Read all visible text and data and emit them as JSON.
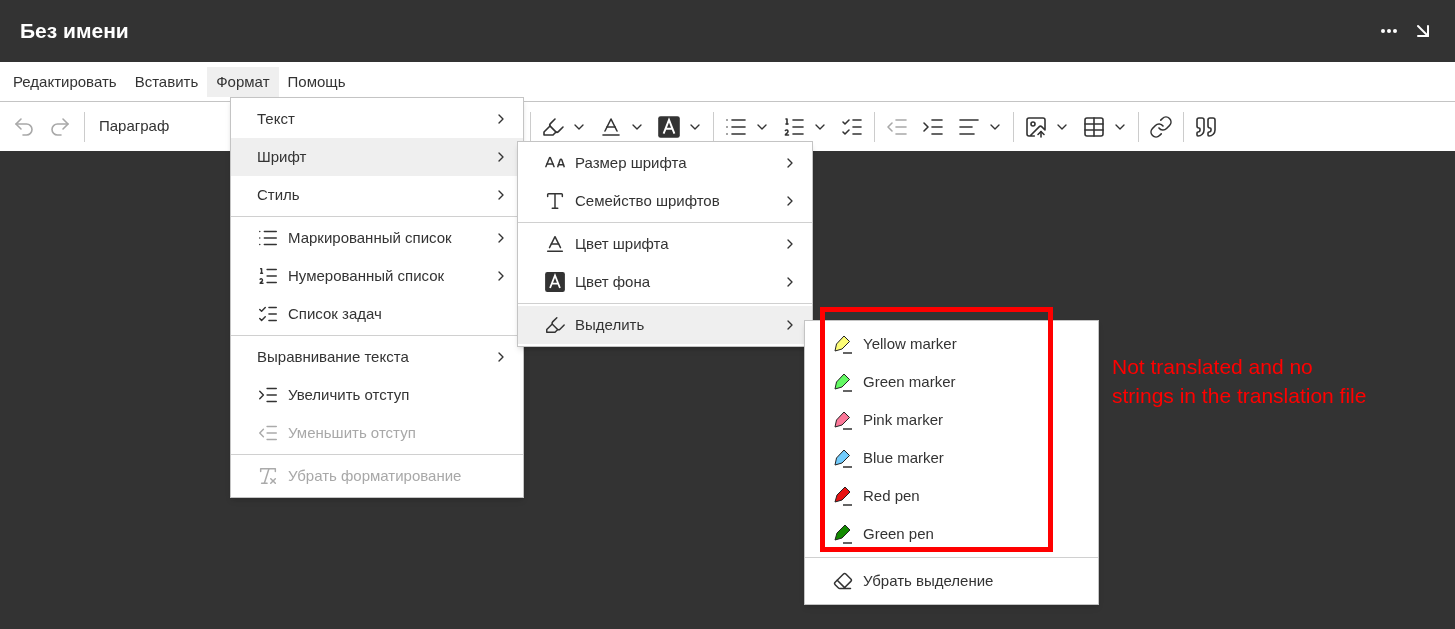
{
  "window": {
    "title": "Без имени"
  },
  "menubar": [
    {
      "label": "Редактировать",
      "selected": false
    },
    {
      "label": "Вставить",
      "selected": false
    },
    {
      "label": "Формат",
      "selected": true
    },
    {
      "label": "Помощь",
      "selected": false
    }
  ],
  "toolbar": {
    "left": [
      {
        "kind": "undo",
        "disabled": true,
        "dropdown": false
      },
      {
        "kind": "redo",
        "disabled": true,
        "dropdown": false
      }
    ],
    "paragraph": "Параграф",
    "right": [
      [
        {
          "kind": "highlight",
          "disabled": false,
          "dropdown": true
        },
        {
          "kind": "font-color",
          "disabled": false,
          "dropdown": true
        },
        {
          "kind": "background-color",
          "disabled": false,
          "dropdown": true
        }
      ],
      [
        {
          "kind": "bulleted-list",
          "disabled": false,
          "dropdown": true
        },
        {
          "kind": "numbered-list",
          "disabled": false,
          "dropdown": true
        },
        {
          "kind": "todo-list",
          "disabled": false,
          "dropdown": false
        }
      ],
      [
        {
          "kind": "outdent",
          "disabled": true,
          "dropdown": false
        },
        {
          "kind": "indent",
          "disabled": false,
          "dropdown": false
        },
        {
          "kind": "align",
          "disabled": false,
          "dropdown": true
        }
      ],
      [
        {
          "kind": "image",
          "disabled": false,
          "dropdown": true
        },
        {
          "kind": "table",
          "disabled": false,
          "dropdown": true
        }
      ],
      [
        {
          "kind": "link",
          "disabled": false,
          "dropdown": false
        }
      ],
      [
        {
          "kind": "quote",
          "disabled": false,
          "dropdown": false
        }
      ]
    ]
  },
  "format_menu": [
    [
      {
        "label": "Текст",
        "kind": "plain",
        "submenu": true,
        "disabled": false,
        "selected": false
      },
      {
        "label": "Шрифт",
        "kind": "plain",
        "submenu": true,
        "disabled": false,
        "selected": true
      },
      {
        "label": "Стиль",
        "kind": "plain",
        "submenu": true,
        "disabled": false,
        "selected": false
      }
    ],
    [
      {
        "label": "Маркированный список",
        "kind": "bulleted-list",
        "submenu": true,
        "disabled": false,
        "selected": false
      },
      {
        "label": "Нумерованный список",
        "kind": "numbered-list",
        "submenu": true,
        "disabled": false,
        "selected": false
      },
      {
        "label": "Список задач",
        "kind": "todo-list",
        "submenu": false,
        "disabled": false,
        "selected": false
      }
    ],
    [
      {
        "label": "Выравнивание текста",
        "kind": "plain",
        "submenu": true,
        "disabled": false,
        "selected": false
      },
      {
        "label": "Увеличить отступ",
        "kind": "indent",
        "submenu": false,
        "disabled": false,
        "selected": false
      },
      {
        "label": "Уменьшить отступ",
        "kind": "outdent",
        "submenu": false,
        "disabled": true,
        "selected": false
      }
    ],
    [
      {
        "label": "Убрать форматирование",
        "kind": "remove-format",
        "submenu": false,
        "disabled": true,
        "selected": false
      }
    ]
  ],
  "font_menu": [
    [
      {
        "label": "Размер шрифта",
        "kind": "font-size",
        "submenu": true,
        "disabled": false,
        "selected": false
      },
      {
        "label": "Семейство шрифтов",
        "kind": "font-family",
        "submenu": true,
        "disabled": false,
        "selected": false
      }
    ],
    [
      {
        "label": "Цвет шрифта",
        "kind": "font-color",
        "submenu": true,
        "disabled": false,
        "selected": false
      },
      {
        "label": "Цвет фона",
        "kind": "background-color",
        "submenu": true,
        "disabled": false,
        "selected": false
      }
    ],
    [
      {
        "label": "Выделить",
        "kind": "highlight",
        "submenu": true,
        "disabled": false,
        "selected": true
      }
    ]
  ],
  "highlight_menu": {
    "items": [
      {
        "label": "Yellow marker",
        "kind": "marker",
        "color": "#fdfd77"
      },
      {
        "label": "Green marker",
        "kind": "marker",
        "color": "#62f962"
      },
      {
        "label": "Pink marker",
        "kind": "marker",
        "color": "#fc7899"
      },
      {
        "label": "Blue marker",
        "kind": "marker",
        "color": "#72ccfd"
      },
      {
        "label": "Red pen",
        "kind": "pen",
        "color": "#e71313"
      },
      {
        "label": "Green pen",
        "kind": "pen",
        "color": "#128a00"
      }
    ],
    "remove": "Убрать выделение"
  },
  "annotation": {
    "lines": [
      "Not translated and no",
      "strings in the translation file"
    ]
  }
}
